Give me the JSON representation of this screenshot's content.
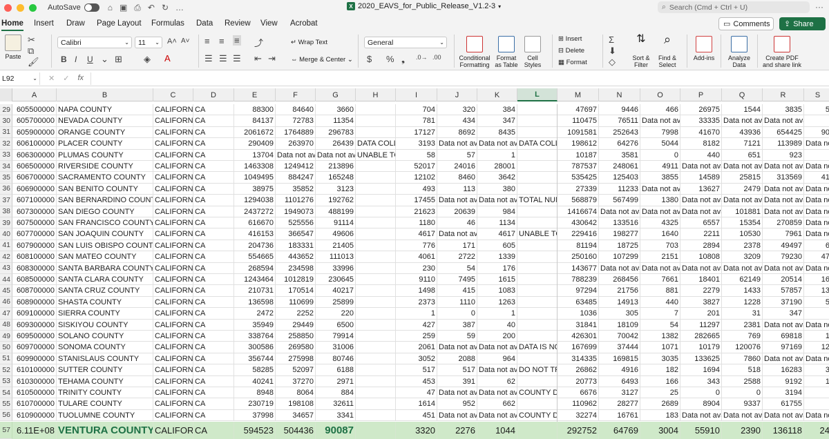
{
  "titlebar": {
    "autosave_label": "AutoSave",
    "doc_title": "2020_EAVS_for_Public_Release_V1.2-3",
    "search_placeholder": "Search (Cmd + Ctrl + U)"
  },
  "tabs": [
    "Home",
    "Insert",
    "Draw",
    "Page Layout",
    "Formulas",
    "Data",
    "Review",
    "View",
    "Acrobat"
  ],
  "buttons": {
    "comments": "Comments",
    "share": "Share"
  },
  "ribbon": {
    "paste": "Paste",
    "font_name": "Calibri",
    "font_size": "11",
    "bold": "B",
    "italic": "I",
    "underline": "U",
    "wrap_text": "Wrap Text",
    "merge_center": "Merge & Center",
    "number_format": "General",
    "currency": "$",
    "percent": "%",
    "conditional_formatting": "Conditional Formatting",
    "format_as_table": "Format as Table",
    "cell_styles": "Cell Styles",
    "insert": "Insert",
    "delete": "Delete",
    "format": "Format",
    "sort_filter": "Sort & Filter",
    "find_select": "Find & Select",
    "addins": "Add-ins",
    "analyze_data": "Analyze Data",
    "create_pdf": "Create PDF and share link"
  },
  "formula_bar": {
    "name_box": "L92",
    "fx": "fx"
  },
  "columns": [
    "A",
    "B",
    "C",
    "D",
    "E",
    "F",
    "G",
    "H",
    "I",
    "J",
    "K",
    "L",
    "M",
    "N",
    "O",
    "P",
    "Q",
    "R",
    "S"
  ],
  "selected_column": "L",
  "rows": [
    {
      "n": "29",
      "c": [
        "605500000",
        "NAPA COUNTY",
        "CALIFORNIA",
        "CA",
        "88300",
        "84640",
        "3660",
        "",
        "704",
        "320",
        "384",
        "",
        "47697",
        "9446",
        "466",
        "26975",
        "1544",
        "3835",
        "5"
      ]
    },
    {
      "n": "30",
      "c": [
        "605700000",
        "NEVADA COUNTY",
        "CALIFORNIA",
        "CA",
        "84137",
        "72783",
        "11354",
        "",
        "781",
        "434",
        "347",
        "",
        "110475",
        "76511",
        "Data not ava",
        "33335",
        "Data not ava",
        "Data not ava",
        ""
      ]
    },
    {
      "n": "31",
      "c": [
        "605900000",
        "ORANGE COUNTY",
        "CALIFORNIA",
        "CA",
        "2061672",
        "1764889",
        "296783",
        "",
        "17127",
        "8692",
        "8435",
        "",
        "1091581",
        "252643",
        "7998",
        "41670",
        "43936",
        "654425",
        "90"
      ]
    },
    {
      "n": "32",
      "c": [
        "606100000",
        "PLACER COUNTY",
        "CALIFORNIA",
        "CA",
        "290409",
        "263970",
        "26439",
        "DATA COLLE",
        "3193",
        "Data not ava",
        "Data not ava",
        "DATA COLLE",
        "198612",
        "64276",
        "5044",
        "8182",
        "7121",
        "113989",
        "Data no"
      ]
    },
    {
      "n": "33",
      "c": [
        "606300000",
        "PLUMAS COUNTY",
        "CALIFORNIA",
        "CA",
        "13704",
        "Data not ava",
        "Data not ava",
        "UNABLE TO",
        "58",
        "57",
        "1",
        "",
        "10187",
        "3581",
        "0",
        "440",
        "651",
        "923",
        ""
      ]
    },
    {
      "n": "34",
      "c": [
        "606500000",
        "RIVERSIDE COUNTY",
        "CALIFORNIA",
        "CA",
        "1463308",
        "1249412",
        "213896",
        "",
        "52017",
        "24016",
        "28001",
        "",
        "787537",
        "248061",
        "4911",
        "Data not ava",
        "Data not ava",
        "Data not ava",
        "Data no"
      ]
    },
    {
      "n": "35",
      "c": [
        "606700000",
        "SACRAMENTO COUNTY",
        "CALIFORNIA",
        "CA",
        "1049495",
        "884247",
        "165248",
        "",
        "12102",
        "8460",
        "3642",
        "",
        "535425",
        "125403",
        "3855",
        "14589",
        "25815",
        "313569",
        "41"
      ]
    },
    {
      "n": "36",
      "c": [
        "606900000",
        "SAN BENITO COUNTY",
        "CALIFORNIA",
        "CA",
        "38975",
        "35852",
        "3123",
        "",
        "493",
        "113",
        "380",
        "",
        "27339",
        "11233",
        "Data not ava",
        "13627",
        "2479",
        "Data not ava",
        "Data no"
      ]
    },
    {
      "n": "37",
      "c": [
        "607100000",
        "SAN BERNARDINO COUNTY",
        "CALIFORNIA",
        "CA",
        "1294038",
        "1101276",
        "192762",
        "",
        "17455",
        "Data not ava",
        "Data not ava",
        "TOTAL NUM",
        "568879",
        "567499",
        "1380",
        "Data not ava",
        "Data not ava",
        "Data not ava",
        "Data no"
      ]
    },
    {
      "n": "38",
      "c": [
        "607300000",
        "SAN DIEGO COUNTY",
        "CALIFORNIA",
        "CA",
        "2437272",
        "1949073",
        "488199",
        "",
        "21623",
        "20639",
        "984",
        "",
        "1416674",
        "Data not ava",
        "Data not ava",
        "Data not ava",
        "101881",
        "Data not ava",
        "Data no"
      ]
    },
    {
      "n": "39",
      "c": [
        "607500000",
        "SAN FRANCISCO COUNTY",
        "CALIFORNIA",
        "CA",
        "616670",
        "525556",
        "91114",
        "",
        "1180",
        "46",
        "1134",
        "",
        "430642",
        "133516",
        "4325",
        "6557",
        "15354",
        "270859",
        "Data no"
      ]
    },
    {
      "n": "40",
      "c": [
        "607700000",
        "SAN JOAQUIN COUNTY",
        "CALIFORNIA",
        "CA",
        "416153",
        "366547",
        "49606",
        "",
        "4617",
        "Data not ava",
        "4617",
        "UNABLE TO",
        "229416",
        "198277",
        "1640",
        "2211",
        "10530",
        "7961",
        "Data no"
      ]
    },
    {
      "n": "41",
      "c": [
        "607900000",
        "SAN LUIS OBISPO COUNTY",
        "CALIFORNIA",
        "CA",
        "204736",
        "183331",
        "21405",
        "",
        "776",
        "171",
        "605",
        "",
        "81194",
        "18725",
        "703",
        "2894",
        "2378",
        "49497",
        "6"
      ]
    },
    {
      "n": "42",
      "c": [
        "608100000",
        "SAN MATEO COUNTY",
        "CALIFORNIA",
        "CA",
        "554665",
        "443652",
        "111013",
        "",
        "4061",
        "2722",
        "1339",
        "",
        "250160",
        "107299",
        "2151",
        "10808",
        "3209",
        "79230",
        "47"
      ]
    },
    {
      "n": "43",
      "c": [
        "608300000",
        "SANTA BARBARA COUNTY",
        "CALIFORNIA",
        "CA",
        "268594",
        "234598",
        "33996",
        "",
        "230",
        "54",
        "176",
        "",
        "143677",
        "Data not ava",
        "Data not ava",
        "Data not ava",
        "Data not ava",
        "Data not ava",
        "Data no"
      ]
    },
    {
      "n": "44",
      "c": [
        "608500000",
        "SANTA CLARA COUNTY",
        "CALIFORNIA",
        "CA",
        "1243464",
        "1012819",
        "230645",
        "",
        "9110",
        "7495",
        "1615",
        "",
        "788239",
        "268456",
        "7661",
        "18401",
        "62149",
        "20514",
        "16"
      ]
    },
    {
      "n": "45",
      "c": [
        "608700000",
        "SANTA CRUZ COUNTY",
        "CALIFORNIA",
        "CA",
        "210731",
        "170514",
        "40217",
        "",
        "1498",
        "415",
        "1083",
        "",
        "97294",
        "21756",
        "881",
        "2279",
        "1433",
        "57857",
        "13"
      ]
    },
    {
      "n": "46",
      "c": [
        "608900000",
        "SHASTA COUNTY",
        "CALIFORNIA",
        "CA",
        "136598",
        "110699",
        "25899",
        "",
        "2373",
        "1110",
        "1263",
        "",
        "63485",
        "14913",
        "440",
        "3827",
        "1228",
        "37190",
        "5"
      ]
    },
    {
      "n": "47",
      "c": [
        "609100000",
        "SIERRA COUNTY",
        "CALIFORNIA",
        "CA",
        "2472",
        "2252",
        "220",
        "",
        "1",
        "0",
        "1",
        "",
        "1036",
        "305",
        "7",
        "201",
        "31",
        "347",
        ""
      ]
    },
    {
      "n": "48",
      "c": [
        "609300000",
        "SISKIYOU COUNTY",
        "CALIFORNIA",
        "CA",
        "35949",
        "29449",
        "6500",
        "",
        "427",
        "387",
        "40",
        "",
        "31841",
        "18109",
        "54",
        "11297",
        "2381",
        "Data not ava",
        "Data no"
      ]
    },
    {
      "n": "49",
      "c": [
        "609500000",
        "SOLANO COUNTY",
        "CALIFORNIA",
        "CA",
        "338764",
        "258850",
        "79914",
        "",
        "259",
        "59",
        "200",
        "",
        "426301",
        "70042",
        "1382",
        "282665",
        "769",
        "69818",
        "1"
      ]
    },
    {
      "n": "50",
      "c": [
        "609700000",
        "SONOMA COUNTY",
        "CALIFORNIA",
        "CA",
        "300586",
        "269580",
        "31006",
        "",
        "2061",
        "Data not ava",
        "Data not ava",
        "DATA IS NO",
        "167699",
        "37444",
        "1071",
        "10179",
        "120076",
        "97169",
        "12"
      ]
    },
    {
      "n": "51",
      "c": [
        "609900000",
        "STANISLAUS COUNTY",
        "CALIFORNIA",
        "CA",
        "356744",
        "275998",
        "80746",
        "",
        "3052",
        "2088",
        "964",
        "",
        "314335",
        "169815",
        "3035",
        "133625",
        "7860",
        "Data not ava",
        "Data no"
      ]
    },
    {
      "n": "52",
      "c": [
        "610100000",
        "SUTTER COUNTY",
        "CALIFORNIA",
        "CA",
        "58285",
        "52097",
        "6188",
        "",
        "517",
        "517",
        "Data not ava",
        "DO NOT TRA",
        "26862",
        "4916",
        "182",
        "1694",
        "518",
        "16283",
        "3"
      ]
    },
    {
      "n": "53",
      "c": [
        "610300000",
        "TEHAMA COUNTY",
        "CALIFORNIA",
        "CA",
        "40241",
        "37270",
        "2971",
        "",
        "453",
        "391",
        "62",
        "",
        "20773",
        "6493",
        "166",
        "343",
        "2588",
        "9192",
        "1"
      ]
    },
    {
      "n": "54",
      "c": [
        "610500000",
        "TRINITY COUNTY",
        "CALIFORNIA",
        "CA",
        "8948",
        "8064",
        "884",
        "",
        "47",
        "Data not ava",
        "Data not ava",
        "COUNTY DC",
        "6676",
        "3127",
        "25",
        "0",
        "0",
        "3194",
        ""
      ]
    },
    {
      "n": "55",
      "c": [
        "610700000",
        "TULARE COUNTY",
        "CALIFORNIA",
        "CA",
        "230719",
        "198108",
        "32611",
        "",
        "1614",
        "952",
        "662",
        "",
        "110962",
        "28277",
        "2689",
        "8904",
        "9337",
        "61755",
        ""
      ]
    },
    {
      "n": "56",
      "c": [
        "610900000",
        "TUOLUMNE COUNTY",
        "CALIFORNIA",
        "CA",
        "37998",
        "34657",
        "3341",
        "",
        "451",
        "Data not ava",
        "Data not ava",
        "COUNTY DC",
        "32274",
        "16761",
        "183",
        "Data not ava",
        "Data not ava",
        "Data not ava",
        "Data no"
      ]
    }
  ],
  "highlight_row": {
    "n": "57",
    "c": [
      "6.11E+08",
      "VENTURA COUNTY",
      "CALIFORN",
      "CA",
      "594523",
      "504436",
      "90087",
      "",
      "3320",
      "2276",
      "1044",
      "",
      "292752",
      "64769",
      "3004",
      "55910",
      "2390",
      "136118",
      "24"
    ]
  },
  "colors": {
    "accent": "#1e7145",
    "highlight_row": "#cfe9c9"
  }
}
